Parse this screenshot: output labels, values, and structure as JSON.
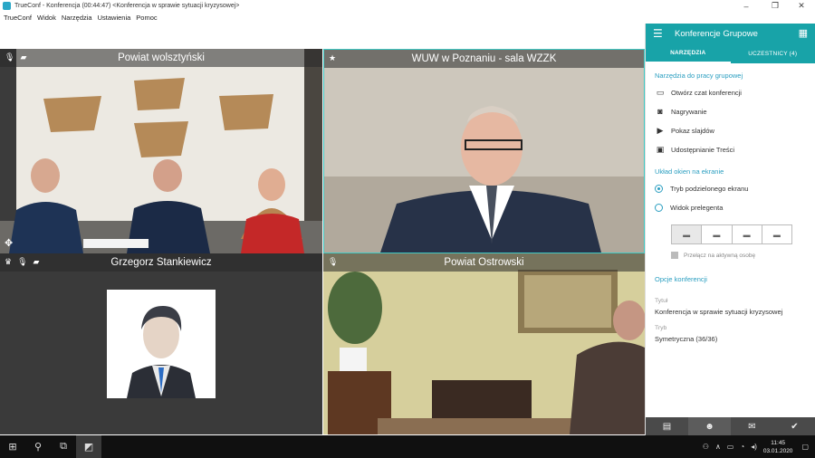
{
  "window": {
    "title": "TrueConf - Konferencja (00:44:47) <Konferencja w sprawie sytuacji kryzysowej>",
    "minimize": "‒",
    "maximize": "❐",
    "close": "✕"
  },
  "menu": [
    "TrueConf",
    "Widok",
    "Narzędzia",
    "Ustawienia",
    "Pomoc"
  ],
  "tiles": [
    {
      "name": "Powiat wolsztyński",
      "icons": [
        "mic-icon",
        "camera-off-icon"
      ]
    },
    {
      "name": "WUW w Poznaniu - sala WZZK",
      "icons": [
        "star-icon"
      ]
    },
    {
      "name": "Grzegorz Stankiewicz",
      "icons": [
        "crown-icon",
        "mic-icon",
        "camera-off-icon"
      ]
    },
    {
      "name": "Powiat Ostrowski",
      "icons": [
        "mic-icon"
      ]
    }
  ],
  "panel": {
    "title": "Konferencje Grupowe",
    "tabs": [
      "NARZĘDZIA",
      "UCZESTNICY (4)"
    ],
    "tools_section": "Narzędzia do pracy grupowej",
    "tools": [
      {
        "label": "Otwórz czat konferencji",
        "icon": "chat-icon"
      },
      {
        "label": "Nagrywanie",
        "icon": "record-icon"
      },
      {
        "label": "Pokaz slajdów",
        "icon": "slideshow-icon"
      },
      {
        "label": "Udostępnianie Treści",
        "icon": "screen-share-icon"
      }
    ],
    "layout_section": "Układ okien na ekranie",
    "layout_options": [
      {
        "label": "Tryb podzielonego ekranu",
        "selected": true
      },
      {
        "label": "Widok prelegenta",
        "selected": false
      }
    ],
    "active_person_label": "Przełącz na aktywną osobę",
    "conf_section": "Opcje konferencji",
    "topic_label": "Tytuł",
    "topic_value": "Konferencja w sprawie sytuacji kryzysowej",
    "mode_label": "Tryb",
    "mode_value": "Symetryczna (36/36)"
  },
  "taskbar": {
    "time": "11:45",
    "date": "03.01.2020"
  },
  "colors": {
    "accent": "#18a3a8",
    "link": "#2a9ec0",
    "taskbar": "#101010"
  }
}
